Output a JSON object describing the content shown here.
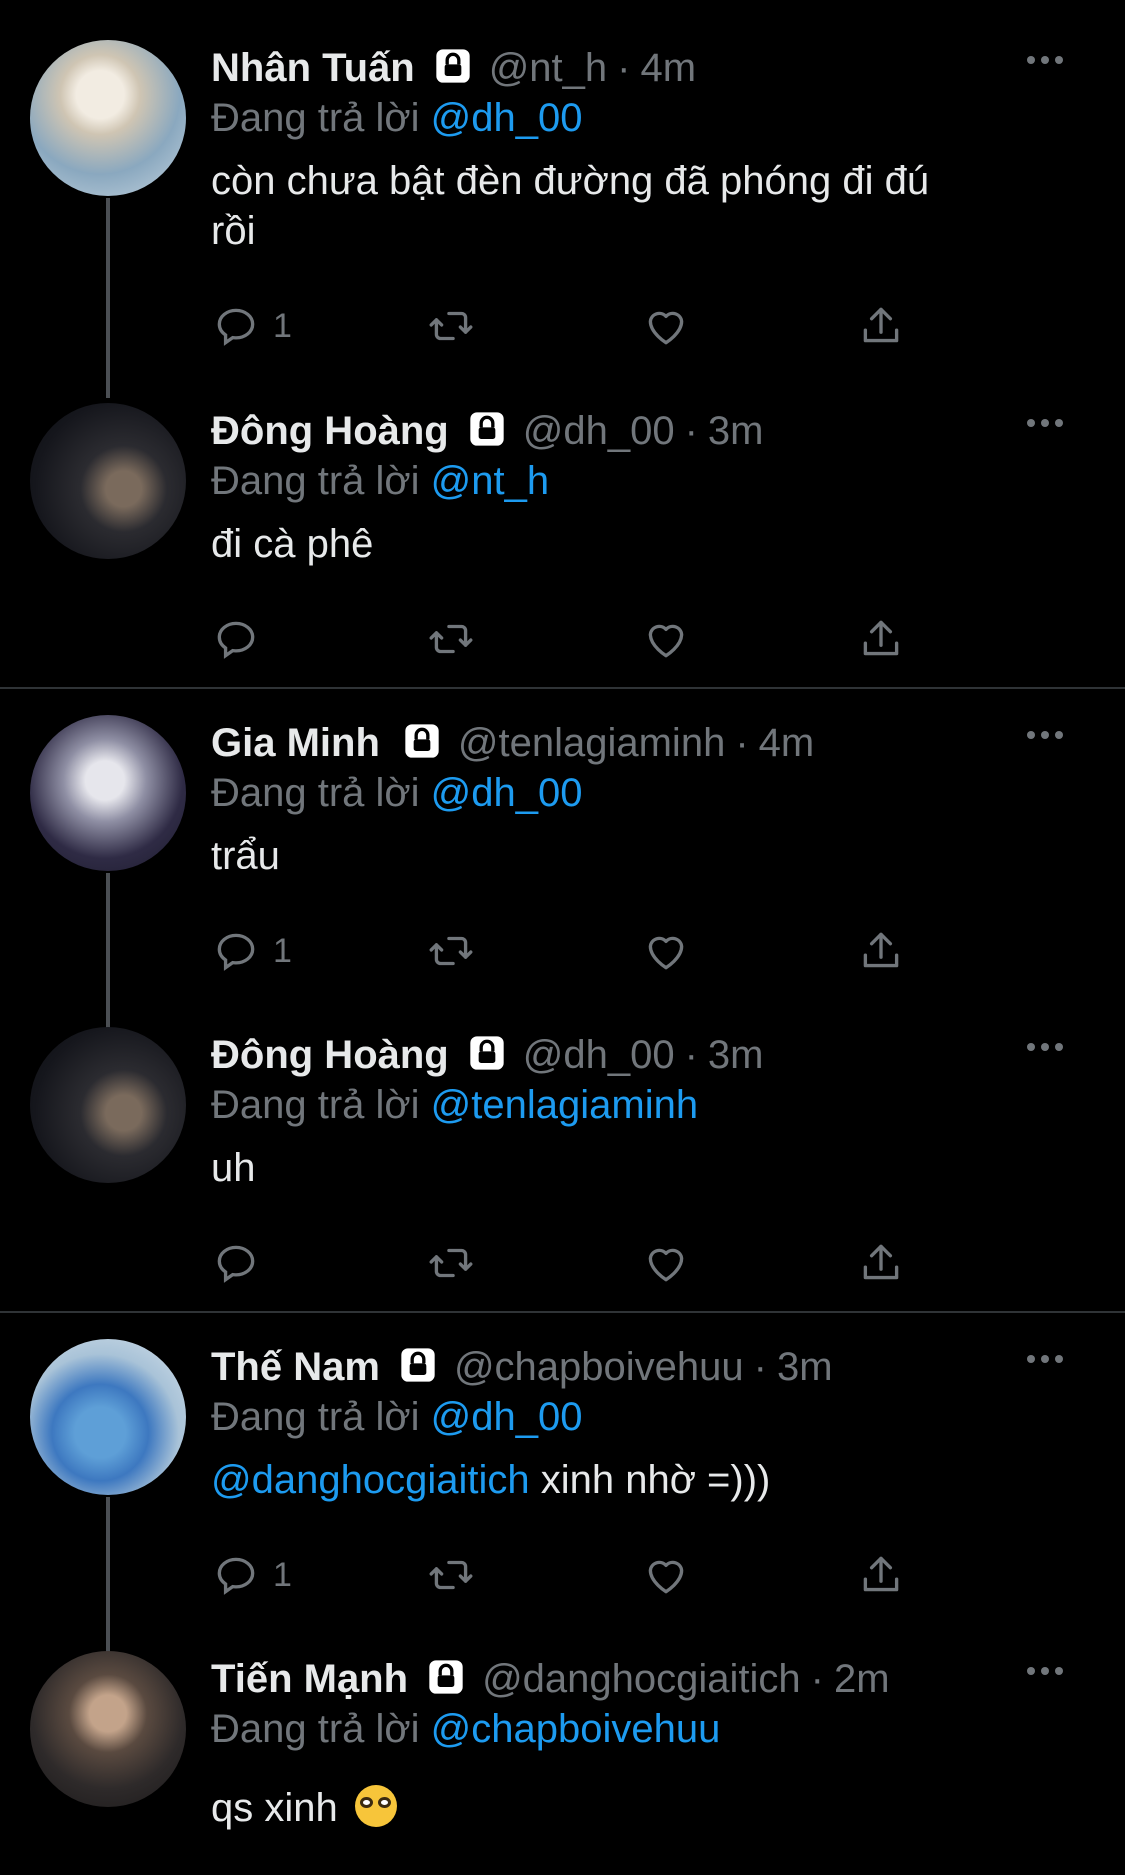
{
  "reply_prefix": "Đang trả lời",
  "colors": {
    "background": "#000000",
    "text": "#e7e9ea",
    "muted": "#71767b",
    "accent": "#1d9bf0",
    "thread_line": "#4b4f54"
  },
  "tweets": [
    {
      "name": "Nhân Tuấn",
      "handle": "@nt_h",
      "time": "4m",
      "reply_to": "@dh_00",
      "text_line1": "còn chưa bật đèn đường đã phóng đi đú",
      "text_line2": "rồi",
      "reply_count": "1",
      "avatar": "avatar-photo"
    },
    {
      "name": "Đông Hoàng",
      "handle": "@dh_00",
      "time": "3m",
      "reply_to": "@nt_h",
      "text_line1": "đi cà phê",
      "reply_count": "",
      "avatar": "avatar-photo"
    },
    {
      "name": "Gia Minh",
      "handle": "@tenlagiaminh",
      "time": "4m",
      "reply_to": "@dh_00",
      "text_line1": "trẩu",
      "reply_count": "1",
      "avatar": "avatar-photo"
    },
    {
      "name": "Đông Hoàng",
      "handle": "@dh_00",
      "time": "3m",
      "reply_to": "@tenlagiaminh",
      "text_line1": "uh",
      "reply_count": "",
      "avatar": "avatar-photo"
    },
    {
      "name": "Thế Nam",
      "handle": "@chapboivehuu",
      "time": "3m",
      "reply_to": "@dh_00",
      "text_mention": "@danghocgiaitich",
      "text_line1": " xinh nhờ =)))",
      "reply_count": "1",
      "avatar": "avatar-photo"
    },
    {
      "name": "Tiến Mạnh",
      "handle": "@danghocgiaitich",
      "time": "2m",
      "reply_to": "@chapboivehuu",
      "text_line1": "qs xinh",
      "emoji": "nerd-face-emoji",
      "avatar": "avatar-photo"
    }
  ],
  "icons": [
    "lock-icon",
    "more-icon",
    "reply-icon",
    "retweet-icon",
    "like-icon",
    "share-icon"
  ]
}
